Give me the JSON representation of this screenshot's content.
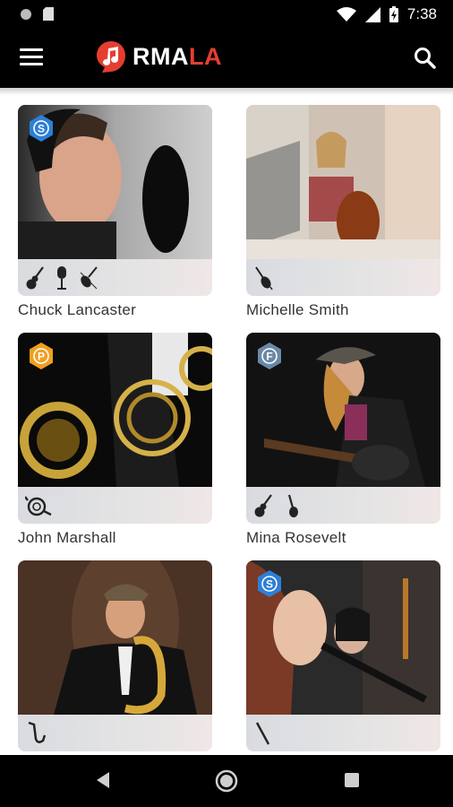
{
  "status_bar": {
    "time": "7:38"
  },
  "app_bar": {
    "brand_part1": "RMA",
    "brand_part2": "LA",
    "brand_colors": {
      "white": "#ffffff",
      "red": "#e53e30"
    }
  },
  "musicians": [
    {
      "name": "Chuck Lancaster",
      "badge": "S",
      "badge_color": "#2d7fd6",
      "instruments": [
        "guitar-icon",
        "microphone-icon",
        "violin-icon"
      ]
    },
    {
      "name": "Michelle Smith",
      "badge": "",
      "badge_color": "",
      "instruments": [
        "cello-icon"
      ]
    },
    {
      "name": "John Marshall",
      "badge": "P",
      "badge_color": "#f0a020",
      "instruments": [
        "french-horn-icon"
      ]
    },
    {
      "name": "Mina Rosevelt",
      "badge": "F",
      "badge_color": "#6a89a6",
      "instruments": [
        "guitar-icon",
        "bass-guitar-icon"
      ]
    },
    {
      "name": "",
      "badge": "",
      "badge_color": "",
      "instruments": [
        "saxophone-icon"
      ]
    },
    {
      "name": "",
      "badge": "S",
      "badge_color": "#2d7fd6",
      "instruments": [
        "clarinet-icon"
      ]
    }
  ]
}
